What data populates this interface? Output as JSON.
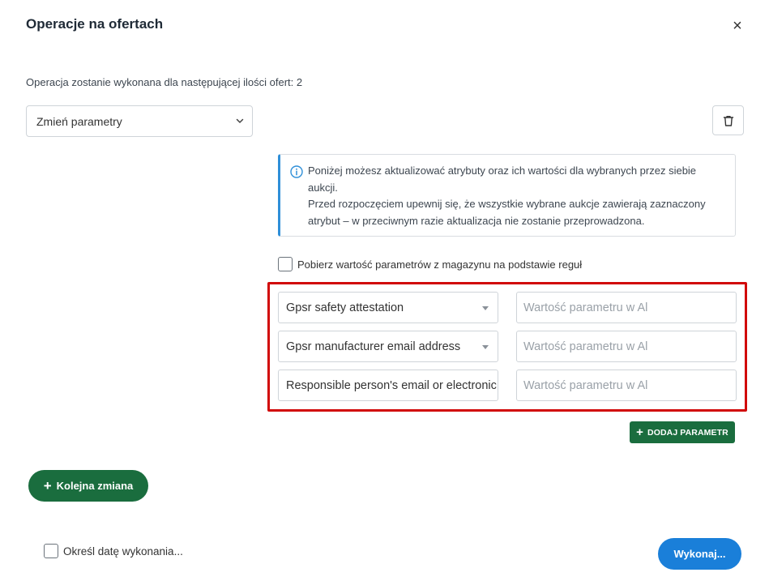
{
  "modal": {
    "title": "Operacje na ofertach",
    "close_glyph": "×"
  },
  "info_line": "Operacja zostanie wykonana dla następującej ilości ofert: 2",
  "operation_select": {
    "value": "Zmień parametry"
  },
  "info_box": {
    "line1": "Poniżej możesz aktualizować atrybuty oraz ich wartości dla wybranych przez siebie aukcji.",
    "line2": "Przed rozpoczęciem upewnij się, że wszystkie wybrane aukcje zawierają zaznaczony atrybut – w przeciwnym razie aktualizacja nie zostanie przeprowadzona."
  },
  "magazyn_checkbox": {
    "label": "Pobierz wartość parametrów z magazynu na podstawie reguł",
    "checked": false
  },
  "parameters": [
    {
      "name": "Gpsr safety attestation",
      "has_caret": true,
      "value_placeholder": "Wartość parametru w Al"
    },
    {
      "name": "Gpsr manufacturer email address",
      "has_caret": true,
      "value_placeholder": "Wartość parametru w Al"
    },
    {
      "name": "Responsible person's email or electronic a",
      "has_caret": false,
      "value_placeholder": "Wartość parametru w Al"
    }
  ],
  "buttons": {
    "add_parameter": "DODAJ PARAMETR",
    "next_change": "Kolejna zmiana",
    "execute": "Wykonaj..."
  },
  "date_checkbox": {
    "label": "Określ datę wykonania...",
    "checked": false
  },
  "colors": {
    "green": "#1a6d3e",
    "blue": "#1a7fd9",
    "highlight_red": "#d10a0a",
    "info_accent": "#2f8fd8"
  },
  "icons": {
    "close": "close-icon",
    "trash": "trash-icon",
    "info": "info-icon",
    "chevron": "chevron-down-icon",
    "plus": "plus-icon"
  }
}
